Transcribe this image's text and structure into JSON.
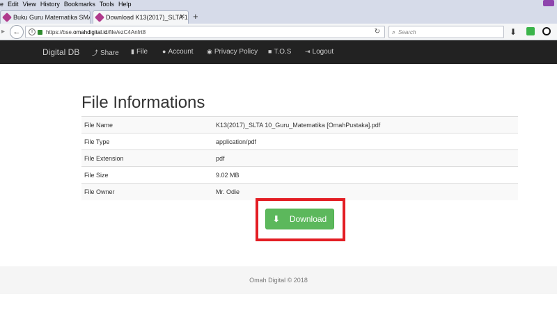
{
  "browser": {
    "menu": [
      "e",
      "Edit",
      "View",
      "History",
      "Bookmarks",
      "Tools",
      "Help"
    ],
    "tabs": [
      {
        "label": "Buku Guru Matematika SMA..."
      },
      {
        "label": "Download K13(2017)_SLTA 1..."
      }
    ],
    "url_prefix": "https://bse.",
    "url_host": "omahdigital.id",
    "url_path": "/file/ezC4Anfrt8",
    "search_placeholder": "Search"
  },
  "site_nav": {
    "brand": "Digital DB",
    "items": [
      {
        "label": "Share",
        "icon": "share-icon"
      },
      {
        "label": "File",
        "icon": "file-icon"
      },
      {
        "label": "Account",
        "icon": "user-icon"
      },
      {
        "label": "Privacy Policy",
        "icon": "eye-icon"
      },
      {
        "label": "T.O.S",
        "icon": "lock-icon"
      },
      {
        "label": "Logout",
        "icon": "logout-icon"
      }
    ]
  },
  "main": {
    "title": "File Informations",
    "rows": [
      {
        "label": "File Name",
        "value": "K13(2017)_SLTA 10_Guru_Matematika [OmahPustaka].pdf"
      },
      {
        "label": "File Type",
        "value": "application/pdf"
      },
      {
        "label": "File Extension",
        "value": "pdf"
      },
      {
        "label": "File Size",
        "value": "9.02 MB"
      },
      {
        "label": "File Owner",
        "value": "Mr. Odie"
      }
    ],
    "download_label": "Download",
    "accent_color": "#5cb85c",
    "highlight_color": "#e31e24"
  },
  "footer": {
    "text": "Omah Digital © 2018"
  }
}
